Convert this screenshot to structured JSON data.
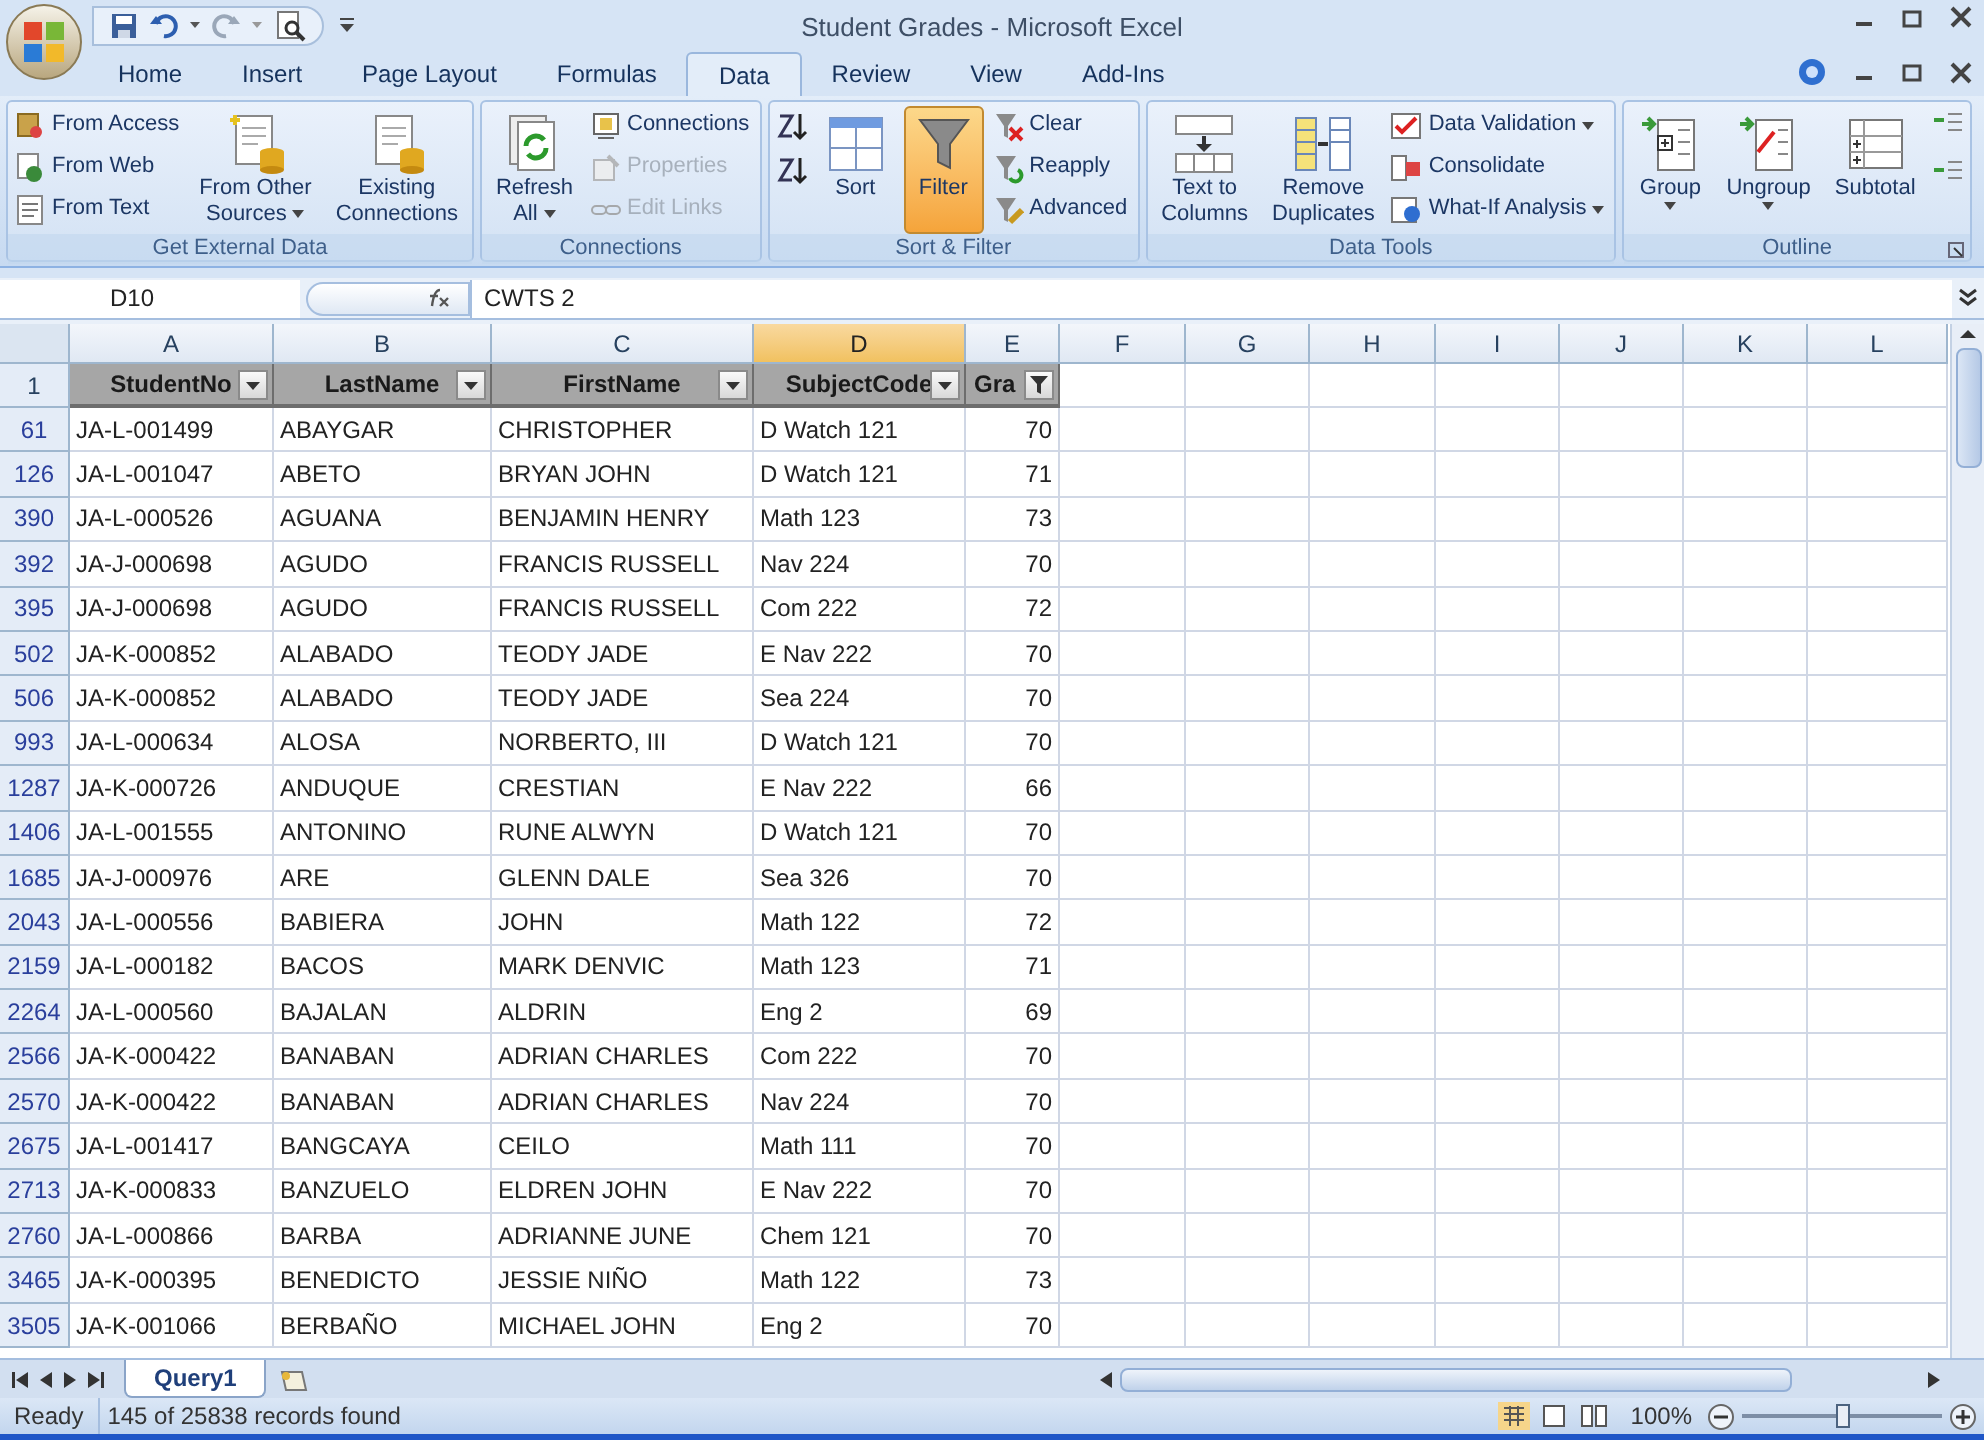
{
  "window": {
    "title": "Student Grades - Microsoft Excel"
  },
  "tabs": [
    {
      "label": "Home",
      "selected": false
    },
    {
      "label": "Insert",
      "selected": false
    },
    {
      "label": "Page Layout",
      "selected": false
    },
    {
      "label": "Formulas",
      "selected": false
    },
    {
      "label": "Data",
      "selected": true
    },
    {
      "label": "Review",
      "selected": false
    },
    {
      "label": "View",
      "selected": false
    },
    {
      "label": "Add-Ins",
      "selected": false
    }
  ],
  "ribbon": {
    "groups": [
      {
        "label": "Get External Data",
        "items": [
          {
            "kind": "small",
            "label": "From Access"
          },
          {
            "kind": "small",
            "label": "From Web"
          },
          {
            "kind": "small",
            "label": "From Text"
          },
          {
            "kind": "large",
            "label": "From Other Sources",
            "dropdown": true
          },
          {
            "kind": "large",
            "label": "Existing Connections"
          }
        ]
      },
      {
        "label": "Connections",
        "items": [
          {
            "kind": "large",
            "label": "Refresh All",
            "dropdown": true
          },
          {
            "kind": "small",
            "label": "Connections",
            "disabled": false
          },
          {
            "kind": "small",
            "label": "Properties",
            "disabled": true
          },
          {
            "kind": "small",
            "label": "Edit Links",
            "disabled": true
          }
        ]
      },
      {
        "label": "Sort & Filter",
        "items": [
          {
            "kind": "icon"
          },
          {
            "kind": "icon"
          },
          {
            "kind": "large",
            "label": "Sort"
          },
          {
            "kind": "large",
            "label": "Filter",
            "selected": true
          },
          {
            "kind": "small",
            "label": "Clear"
          },
          {
            "kind": "small",
            "label": "Reapply"
          },
          {
            "kind": "small",
            "label": "Advanced"
          }
        ]
      },
      {
        "label": "Data Tools",
        "items": [
          {
            "kind": "large",
            "label": "Text to Columns"
          },
          {
            "kind": "large",
            "label": "Remove Duplicates"
          },
          {
            "kind": "small",
            "label": "Data Validation",
            "dropdown": true
          },
          {
            "kind": "small",
            "label": "Consolidate"
          },
          {
            "kind": "small",
            "label": "What-If Analysis",
            "dropdown": true
          }
        ]
      },
      {
        "label": "Outline",
        "items": [
          {
            "kind": "large",
            "label": "Group",
            "dropdown": true
          },
          {
            "kind": "large",
            "label": "Ungroup",
            "dropdown": true
          },
          {
            "kind": "large",
            "label": "Subtotal"
          },
          {
            "kind": "icon"
          },
          {
            "kind": "icon"
          }
        ]
      }
    ]
  },
  "formula_bar": {
    "name_box": "D10",
    "value": "CWTS 2"
  },
  "columns": [
    {
      "letter": "A",
      "selected": false
    },
    {
      "letter": "B",
      "selected": false
    },
    {
      "letter": "C",
      "selected": false
    },
    {
      "letter": "D",
      "selected": true
    },
    {
      "letter": "E",
      "selected": false
    },
    {
      "letter": "F",
      "selected": false
    },
    {
      "letter": "G",
      "selected": false
    },
    {
      "letter": "H",
      "selected": false
    },
    {
      "letter": "I",
      "selected": false
    },
    {
      "letter": "J",
      "selected": false
    },
    {
      "letter": "K",
      "selected": false
    },
    {
      "letter": "L",
      "selected": false
    }
  ],
  "header_row": {
    "number": "1",
    "cells": [
      {
        "text": "StudentNo",
        "filtered": false
      },
      {
        "text": "LastName",
        "filtered": false
      },
      {
        "text": "FirstName",
        "filtered": false
      },
      {
        "text": "SubjectCode",
        "filtered": false
      },
      {
        "text": "Gra",
        "filtered": true
      }
    ]
  },
  "rows": [
    {
      "number": "61",
      "cells": [
        "JA-L-001499",
        "ABAYGAR",
        "CHRISTOPHER",
        "D Watch 121",
        "70"
      ]
    },
    {
      "number": "126",
      "cells": [
        "JA-L-001047",
        "ABETO",
        "BRYAN JOHN",
        "D Watch 121",
        "71"
      ]
    },
    {
      "number": "390",
      "cells": [
        "JA-L-000526",
        "AGUANA",
        "BENJAMIN HENRY",
        "Math 123",
        "73"
      ]
    },
    {
      "number": "392",
      "cells": [
        "JA-J-000698",
        "AGUDO",
        "FRANCIS RUSSELL",
        "Nav 224",
        "70"
      ]
    },
    {
      "number": "395",
      "cells": [
        "JA-J-000698",
        "AGUDO",
        "FRANCIS RUSSELL",
        "Com 222",
        "72"
      ]
    },
    {
      "number": "502",
      "cells": [
        "JA-K-000852",
        "ALABADO",
        "TEODY JADE",
        "E Nav 222",
        "70"
      ]
    },
    {
      "number": "506",
      "cells": [
        "JA-K-000852",
        "ALABADO",
        "TEODY JADE",
        "Sea 224",
        "70"
      ]
    },
    {
      "number": "993",
      "cells": [
        "JA-L-000634",
        "ALOSA",
        "NORBERTO, III",
        "D Watch 121",
        "70"
      ]
    },
    {
      "number": "1287",
      "cells": [
        "JA-K-000726",
        "ANDUQUE",
        "CRESTIAN",
        "E Nav 222",
        "66"
      ]
    },
    {
      "number": "1406",
      "cells": [
        "JA-L-001555",
        "ANTONINO",
        "RUNE ALWYN",
        "D Watch 121",
        "70"
      ]
    },
    {
      "number": "1685",
      "cells": [
        "JA-J-000976",
        "ARE",
        "GLENN DALE",
        "Sea 326",
        "70"
      ]
    },
    {
      "number": "2043",
      "cells": [
        "JA-L-000556",
        "BABIERA",
        "JOHN",
        "Math 122",
        "72"
      ]
    },
    {
      "number": "2159",
      "cells": [
        "JA-L-000182",
        "BACOS",
        "MARK DENVIC",
        "Math 123",
        "71"
      ]
    },
    {
      "number": "2264",
      "cells": [
        "JA-L-000560",
        "BAJALAN",
        "ALDRIN",
        "Eng 2",
        "69"
      ]
    },
    {
      "number": "2566",
      "cells": [
        "JA-K-000422",
        "BANABAN",
        "ADRIAN CHARLES",
        "Com 222",
        "70"
      ]
    },
    {
      "number": "2570",
      "cells": [
        "JA-K-000422",
        "BANABAN",
        "ADRIAN CHARLES",
        "Nav 224",
        "70"
      ]
    },
    {
      "number": "2675",
      "cells": [
        "JA-L-001417",
        "BANGCAYA",
        "CEILO",
        "Math 111",
        "70"
      ]
    },
    {
      "number": "2713",
      "cells": [
        "JA-K-000833",
        "BANZUELO",
        "ELDREN JOHN",
        "E Nav 222",
        "70"
      ]
    },
    {
      "number": "2760",
      "cells": [
        "JA-L-000866",
        "BARBA",
        "ADRIANNE JUNE",
        "Chem 121",
        "70"
      ]
    },
    {
      "number": "3465",
      "cells": [
        "JA-K-000395",
        "BENEDICTO",
        "JESSIE NIÑO",
        "Math 122",
        "73"
      ]
    },
    {
      "number": "3505",
      "cells": [
        "JA-K-001066",
        "BERBAÑO",
        "MICHAEL JOHN",
        "Eng 2",
        "70"
      ]
    }
  ],
  "sheet_tabs": [
    {
      "label": "Query1",
      "selected": true
    }
  ],
  "status_bar": {
    "mode": "Ready",
    "message": "145 of 25838 records found",
    "zoom": "100%",
    "zoom_slider": {
      "level": 0.5
    }
  }
}
